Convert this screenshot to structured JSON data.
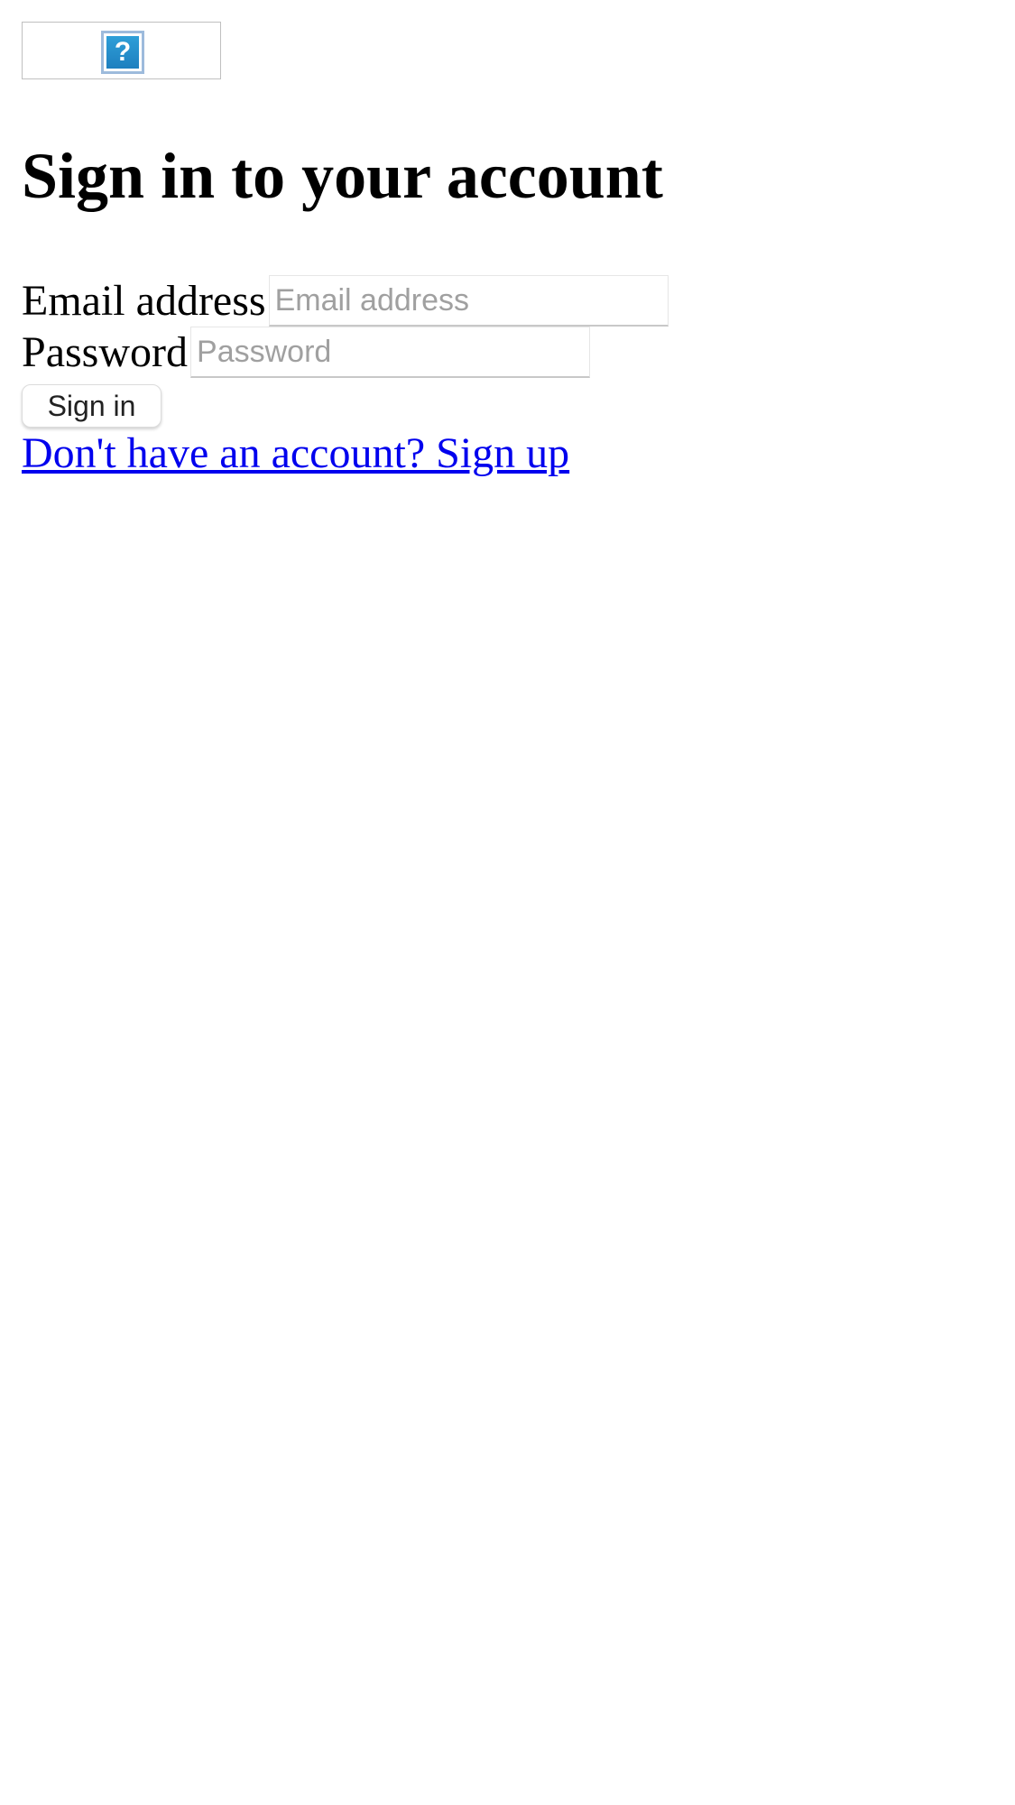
{
  "logo": {
    "alt_icon": "broken-image-icon",
    "glyph": "?"
  },
  "heading": "Sign in to your account",
  "form": {
    "email_label": "Email address",
    "email_placeholder": "Email address",
    "email_value": "",
    "password_label": "Password",
    "password_placeholder": "Password",
    "password_value": "",
    "submit_label": "Sign in"
  },
  "signup_link": "Don't have an account? Sign up",
  "colors": {
    "link": "#0000ee"
  }
}
